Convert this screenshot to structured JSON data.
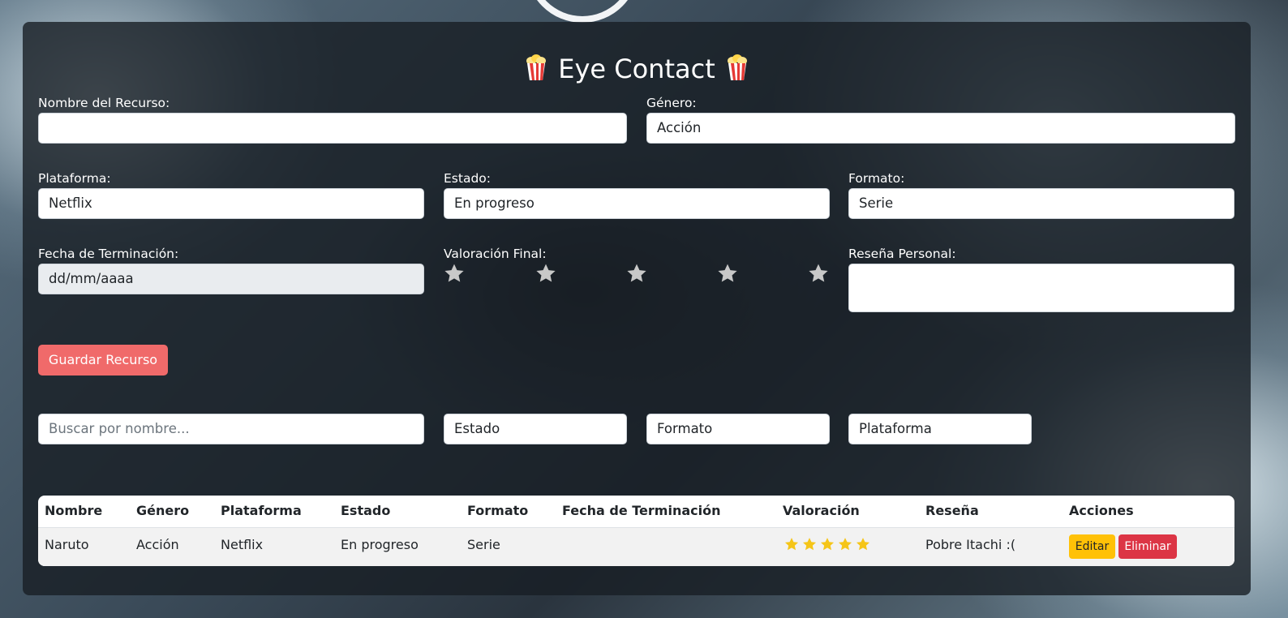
{
  "app": {
    "title": "Eye Contact",
    "title_icon": "popcorn-icon"
  },
  "form": {
    "nombre": {
      "label": "Nombre del Recurso:",
      "value": ""
    },
    "genero": {
      "label": "Género:",
      "value": "Acción"
    },
    "plataforma": {
      "label": "Plataforma:",
      "value": "Netflix"
    },
    "estado": {
      "label": "Estado:",
      "value": "En progreso"
    },
    "formato": {
      "label": "Formato:",
      "value": "Serie"
    },
    "fecha": {
      "label": "Fecha de Terminación:",
      "placeholder": "dd/mm/aaaa"
    },
    "valoracion": {
      "label": "Valoración Final:",
      "rating": 0,
      "max": 5,
      "star_color": "#c8c8c8"
    },
    "resena": {
      "label": "Reseña Personal:",
      "value": ""
    },
    "save_label": "Guardar Recurso"
  },
  "filters": {
    "search_placeholder": "Buscar por nombre...",
    "estado": "Estado",
    "formato": "Formato",
    "plataforma": "Plataforma"
  },
  "table": {
    "headers": [
      "Nombre",
      "Género",
      "Plataforma",
      "Estado",
      "Formato",
      "Fecha de Terminación",
      "Valoración",
      "Reseña",
      "Acciones"
    ],
    "rows": [
      {
        "nombre": "Naruto",
        "genero": "Acción",
        "plataforma": "Netflix",
        "estado": "En progreso",
        "formato": "Serie",
        "fecha": "",
        "valoracion": 5,
        "resena": "Pobre Itachi :(",
        "edit_label": "Editar",
        "delete_label": "Eliminar"
      }
    ]
  },
  "colors": {
    "accent": "#f06a6a",
    "edit": "#ffc107",
    "delete": "#dc3545",
    "rating_star": "#f5c518"
  }
}
